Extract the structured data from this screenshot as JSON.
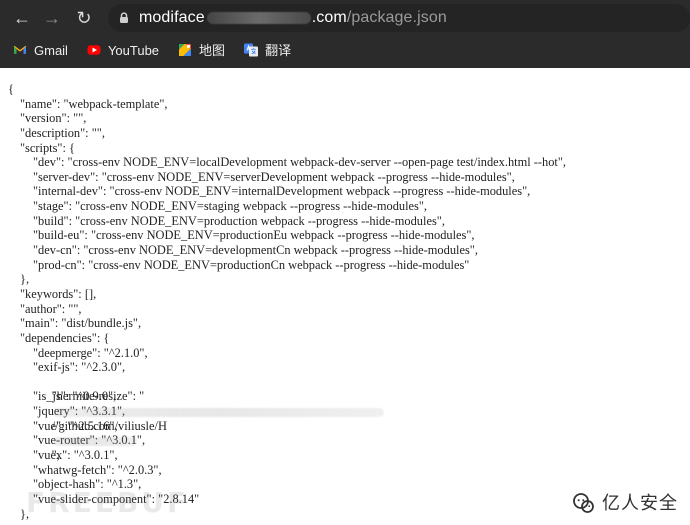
{
  "browser": {
    "nav": {
      "back_icon": "←",
      "forward_icon": "→",
      "reload_icon": "↻"
    },
    "address": {
      "prefix": "modiface",
      "suffix": ".com",
      "path": "/package.json"
    },
    "bookmarks": [
      {
        "label": "Gmail",
        "icon": "gmail-icon"
      },
      {
        "label": "YouTube",
        "icon": "youtube-icon"
      },
      {
        "label": "地图",
        "icon": "maps-icon"
      },
      {
        "label": "翻译",
        "icon": "translate-icon"
      }
    ]
  },
  "document": {
    "lines": [
      "{",
      "\"name\": \"webpack-template\",",
      "\"version\": \"\",",
      "\"description\": \"\",",
      "\"scripts\": {",
      "\"dev\": \"cross-env NODE_ENV=localDevelopment webpack-dev-server --open-page test/index.html --hot\",",
      "\"server-dev\": \"cross-env NODE_ENV=serverDevelopment webpack --progress --hide-modules\",",
      "\"internal-dev\": \"cross-env NODE_ENV=internalDevelopment webpack --progress --hide-modules\",",
      "\"stage\": \"cross-env NODE_ENV=staging webpack --progress --hide-modules\",",
      "\"build\": \"cross-env NODE_ENV=production webpack --progress --hide-modules\",",
      "\"build-eu\": \"cross-env NODE_ENV=productionEu webpack --progress --hide-modules\",",
      "\"dev-cn\": \"cross-env NODE_ENV=developmentCn webpack --progress --hide-modules\",",
      "\"prod-cn\": \"cross-env NODE_ENV=productionCn webpack --progress --hide-modules\"",
      "},",
      "\"keywords\": [],",
      "\"author\": \"\",",
      "\"main\": \"dist/bundle.js\",",
      "\"dependencies\": {",
      "\"deepmerge\": \"^2.1.0\",",
      "\"exif-js\": \"^2.3.0\",",
      "\"hermite-resize\": \"",
      "//github.com/viliusle/H",
      "\",",
      "\"is_js\": \"^0.9.0\",",
      "\"jquery\": \"^3.3.1\",",
      "\"vue\": \"^2.5.16\",",
      "\"vue-router\": \"^3.0.1\",",
      "\"vuex\": \"^3.0.1\",",
      "\"whatwg-fetch\": \"^2.0.3\",",
      "\"object-hash\": \"^1.3\",",
      "\"vue-slider-component\": \"2.8.14\"",
      "},"
    ]
  },
  "watermarks": {
    "bottom_text": "FREEBUF",
    "brand_text": "亿人安全"
  }
}
